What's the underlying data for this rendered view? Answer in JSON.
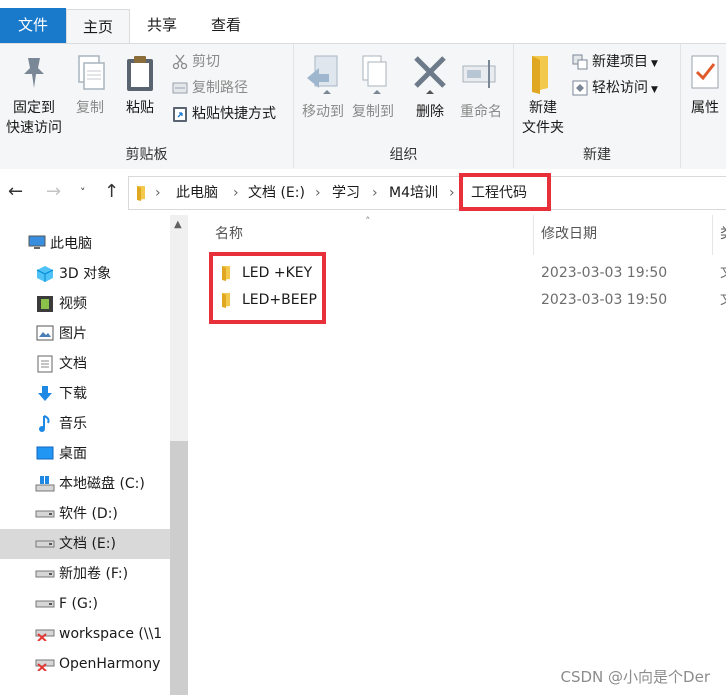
{
  "ribbon_tabs": [
    "文件",
    "主页",
    "共享",
    "查看"
  ],
  "clipboard": {
    "pin_line1": "固定到",
    "pin_line2": "快速访问",
    "copy": "复制",
    "paste": "粘贴",
    "cut": "剪切",
    "copy_path": "复制路径",
    "paste_shortcut": "粘贴快捷方式",
    "group_label": "剪贴板"
  },
  "organize": {
    "move_to": "移动到",
    "copy_to": "复制到",
    "delete": "删除",
    "rename": "重命名",
    "group_label": "组织"
  },
  "new_group": {
    "new_folder_line1": "新建",
    "new_folder_line2": "文件夹",
    "new_item": "新建项目",
    "easy_access": "轻松访问",
    "group_label": "新建"
  },
  "open_group": {
    "properties": "属性"
  },
  "address": {
    "crumbs": [
      "此电脑",
      "文档 (E:)",
      "学习",
      "M4培训",
      "工程代码"
    ]
  },
  "sidebar": {
    "items": [
      {
        "label": "此电脑",
        "icon": "computer-icon"
      },
      {
        "label": "3D 对象",
        "icon": "cube-icon"
      },
      {
        "label": "视频",
        "icon": "film-icon"
      },
      {
        "label": "图片",
        "icon": "picture-icon"
      },
      {
        "label": "文档",
        "icon": "document-icon"
      },
      {
        "label": "下载",
        "icon": "download-arrow-icon"
      },
      {
        "label": "音乐",
        "icon": "music-note-icon"
      },
      {
        "label": "桌面",
        "icon": "desktop-icon"
      },
      {
        "label": "本地磁盘 (C:)",
        "icon": "windows-drive-icon"
      },
      {
        "label": "软件 (D:)",
        "icon": "drive-icon"
      },
      {
        "label": "文档 (E:)",
        "icon": "drive-icon"
      },
      {
        "label": "新加卷 (F:)",
        "icon": "drive-icon"
      },
      {
        "label": "F (G:)",
        "icon": "drive-icon"
      },
      {
        "label": "workspace (\\\\1",
        "icon": "network-drive-disconnected-icon"
      },
      {
        "label": "OpenHarmony",
        "icon": "network-drive-disconnected-icon"
      }
    ]
  },
  "columns": {
    "name": "名称",
    "modified": "修改日期",
    "type_partial": "类"
  },
  "files": [
    {
      "name": "LED +KEY",
      "modified": "2023-03-03 19:50",
      "type_partial": "文"
    },
    {
      "name": "LED+BEEP",
      "modified": "2023-03-03 19:50",
      "type_partial": "文"
    }
  ],
  "watermark": "CSDN @小向是个Der",
  "colors": {
    "file_tab": "#1979ca",
    "highlight_box": "#e8303a",
    "folder": "#f2c94c",
    "selected_item": "#d9d9d9"
  }
}
